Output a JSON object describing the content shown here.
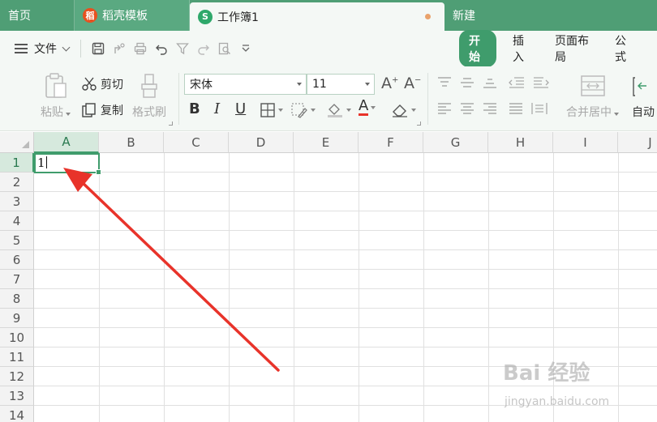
{
  "tabs": {
    "home": "首页",
    "template": "稻壳模板",
    "workbook": "工作簿1",
    "new": "新建",
    "template_icon_glyph": "稻",
    "workbook_icon_glyph": "S"
  },
  "menu": {
    "file": "文件",
    "ribbon_tabs": [
      "开始",
      "插入",
      "页面布局",
      "公式"
    ]
  },
  "ribbon": {
    "paste": "粘贴",
    "cut": "剪切",
    "copy": "复制",
    "format_painter": "格式刷",
    "font_name": "宋体",
    "font_size": "11",
    "bold": "B",
    "italic": "I",
    "underline": "U",
    "font_color": "A",
    "merge_center": "合并居中",
    "auto": "自动"
  },
  "grid": {
    "columns": [
      "A",
      "B",
      "C",
      "D",
      "E",
      "F",
      "G",
      "H",
      "I",
      "J"
    ],
    "rows": [
      "1",
      "2",
      "3",
      "4",
      "5",
      "6",
      "7",
      "8",
      "9",
      "10",
      "11",
      "12",
      "13",
      "14"
    ],
    "active_cell_value": "1"
  },
  "watermark": {
    "brand": "Bai 经验",
    "url": "jingyan.baidu.com"
  },
  "colors": {
    "accent": "#3f9c6c",
    "tabbar": "#4f9e75",
    "arrow": "#e8332a"
  }
}
